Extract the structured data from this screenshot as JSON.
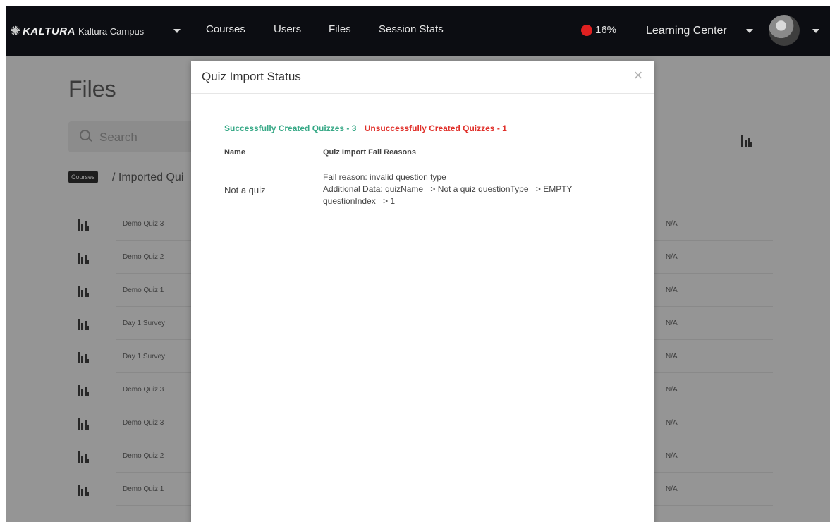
{
  "app": {
    "brand": "KALTURA",
    "site_name": "Kaltura Campus",
    "nav": [
      "Courses",
      "Users",
      "Files",
      "Session Stats"
    ],
    "recording_percent": "16%",
    "learning_center": "Learning Center"
  },
  "page": {
    "title": "Files",
    "search_placeholder": "Search",
    "breadcrumb_badge": "Courses",
    "breadcrumb_text": "/ Imported Qui"
  },
  "file_rows": [
    {
      "name": "Demo Quiz 3",
      "value": "N/A"
    },
    {
      "name": "Demo Quiz 2",
      "value": "N/A"
    },
    {
      "name": "Demo Quiz 1",
      "value": "N/A"
    },
    {
      "name": "Day 1 Survey",
      "value": "N/A"
    },
    {
      "name": "Day 1 Survey",
      "value": "N/A"
    },
    {
      "name": "Demo Quiz 3",
      "value": "N/A"
    },
    {
      "name": "Demo Quiz 3",
      "value": "N/A"
    },
    {
      "name": "Demo Quiz 2",
      "value": "N/A"
    },
    {
      "name": "Demo Quiz 1",
      "value": "N/A"
    }
  ],
  "modal": {
    "title": "Quiz Import Status",
    "close_symbol": "×",
    "success_text": "Successfully Created Quizzes - 3",
    "fail_text": "Unsuccessfully Created Quizzes - 1",
    "col_name": "Name",
    "col_reasons": "Quiz Import Fail Reasons",
    "failed_item": {
      "name": "Not a quiz",
      "fail_reason_label": "Fail reason:",
      "fail_reason_value": " invalid question type",
      "additional_label": "Additional Data:",
      "additional_value": " quizName => Not a quiz questionType => EMPTY questionIndex => 1"
    }
  },
  "colors": {
    "nav_bg": "#0c0d12",
    "success": "#38a987",
    "fail": "#e0302a",
    "rec": "#e02020"
  }
}
